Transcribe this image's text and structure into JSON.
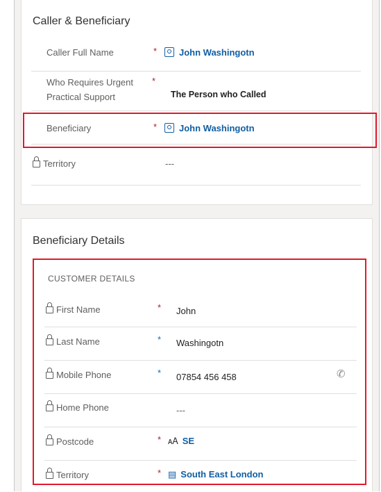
{
  "sections": {
    "caller": {
      "title": "Caller & Beneficiary",
      "rows": [
        {
          "label": "Caller Full Name",
          "required": "*",
          "value": "John Washingotn"
        },
        {
          "label_line1": "Who Requires Urgent",
          "label_line2": "Practical Support",
          "required": "*",
          "value": "The Person who Called"
        },
        {
          "label": "Beneficiary",
          "required": "*",
          "value": "John Washingotn"
        },
        {
          "label": "Territory",
          "value": "---"
        }
      ]
    },
    "beneficiary": {
      "title": "Beneficiary Details",
      "subheader": "CUSTOMER DETAILS",
      "rows": [
        {
          "label": "First Name",
          "required": "*",
          "value": "John"
        },
        {
          "label": "Last Name",
          "recommended": "*",
          "value": "Washingotn"
        },
        {
          "label": "Mobile Phone",
          "recommended": "*",
          "value": "07854 456 458"
        },
        {
          "label": "Home Phone",
          "value": "---"
        },
        {
          "label": "Postcode",
          "required": "*",
          "value": "SE"
        },
        {
          "label": "Territory",
          "required": "*",
          "value": "South East London"
        }
      ]
    }
  },
  "icons": {
    "lookup": "contact-card-icon",
    "lock": "lock-icon",
    "postcode": "postcode-icon",
    "map": "map-icon",
    "phone": "phone-icon"
  },
  "colors": {
    "highlight": "#e0192b",
    "link": "#115ea3",
    "required": "#a4262c",
    "recommended": "#0f6cbd"
  }
}
